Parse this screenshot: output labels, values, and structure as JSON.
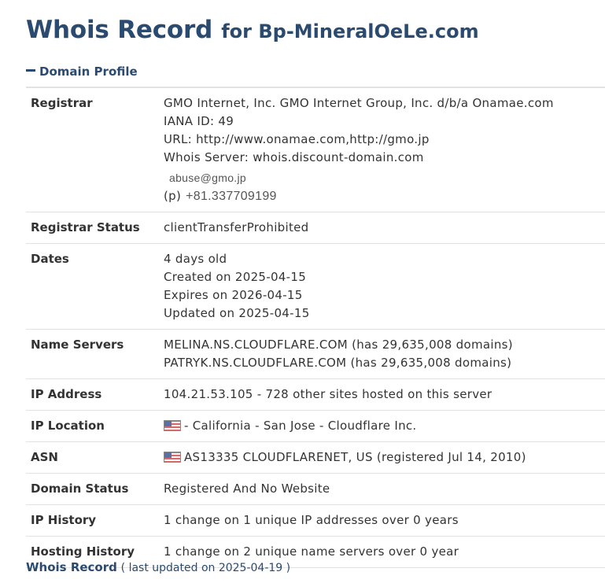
{
  "header": {
    "title_main": "Whois Record",
    "title_sub": "for Bp-MineralOeLe.com"
  },
  "section": {
    "label": "Domain Profile"
  },
  "rows": {
    "registrar": {
      "label": "Registrar",
      "name": "GMO Internet, Inc. GMO Internet Group, Inc. d/b/a Onamae.com",
      "iana": "IANA ID: 49",
      "url": "URL: http://www.onamae.com,http://gmo.jp",
      "whois_server": "Whois Server: whois.discount-domain.com",
      "email": "abuse@gmo.jp",
      "phone_label": "(p)",
      "phone": "+81.337709199"
    },
    "registrar_status": {
      "label": "Registrar Status",
      "value": "clientTransferProhibited"
    },
    "dates": {
      "label": "Dates",
      "age": "4 days old",
      "created": "Created on 2025-04-15",
      "expires": "Expires on 2026-04-15",
      "updated": "Updated on 2025-04-15"
    },
    "name_servers": {
      "label": "Name Servers",
      "ns1": "MELINA.NS.CLOUDFLARE.COM (has 29,635,008 domains)",
      "ns2": "PATRYK.NS.CLOUDFLARE.COM (has 29,635,008 domains)"
    },
    "ip_address": {
      "label": "IP Address",
      "value": "104.21.53.105 - 728 other sites hosted on this server"
    },
    "ip_location": {
      "label": "IP Location",
      "value": "- California - San Jose - Cloudflare Inc."
    },
    "asn": {
      "label": "ASN",
      "value": "AS13335 CLOUDFLARENET, US (registered Jul 14, 2010)"
    },
    "domain_status": {
      "label": "Domain Status",
      "value": "Registered And No Website"
    },
    "ip_history": {
      "label": "IP History",
      "value": "1 change on 1 unique IP addresses over 0 years"
    },
    "hosting_history": {
      "label": "Hosting History",
      "value": "1 change on 2 unique name servers over 0 year"
    }
  },
  "footer": {
    "link": "Whois Record",
    "note": "( last updated on 2025-04-19 )"
  },
  "icons": {
    "flag": "us-flag-icon",
    "collapse": "minus-icon"
  },
  "colors": {
    "heading": "#2b4a6f",
    "text": "#333333",
    "border": "#e2e2e2"
  }
}
